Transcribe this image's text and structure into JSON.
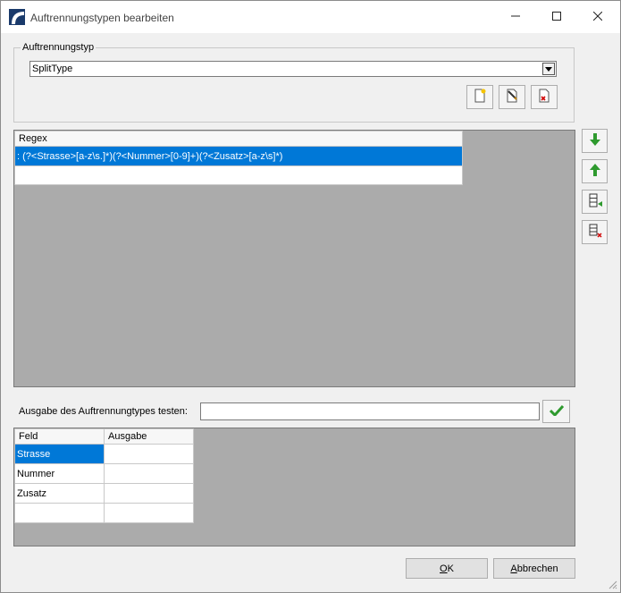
{
  "window": {
    "title": "Auftrennungstypen bearbeiten",
    "icon": "app-logo-icon",
    "controls": [
      "minimize-icon",
      "maximize-icon",
      "close-icon"
    ]
  },
  "group": {
    "legend": "Auftrennungstyp",
    "combo_value": "SplitType",
    "toolbar": [
      "new-document-icon",
      "edit-document-icon",
      "delete-document-icon"
    ]
  },
  "regex_grid": {
    "header": "Regex",
    "rows": [
      ": (?<Strasse>[a-z\\s.]*)(?<Nummer>[0-9]+)(?<Zusatz>[a-z\\s]*)",
      ""
    ]
  },
  "side_buttons": [
    "move-down-arrow-icon",
    "move-up-arrow-icon",
    "add-row-icon",
    "delete-row-icon"
  ],
  "test": {
    "label": "Ausgabe des Auftrennungtypes testen:",
    "input_value": "",
    "button_icon": "checkmark-icon"
  },
  "output_grid": {
    "headers": [
      "Feld",
      "Ausgabe"
    ],
    "rows": [
      [
        "Strasse",
        ""
      ],
      [
        "Nummer",
        ""
      ],
      [
        "Zusatz",
        ""
      ],
      [
        "",
        ""
      ]
    ]
  },
  "buttons": {
    "ok_accel": "O",
    "ok_rest": "K",
    "cancel_accel": "A",
    "cancel_rest": "bbrechen"
  },
  "colors": {
    "selection": "#0078d7",
    "grid_background": "#ababab",
    "accent_green": "#2e9a2e"
  }
}
